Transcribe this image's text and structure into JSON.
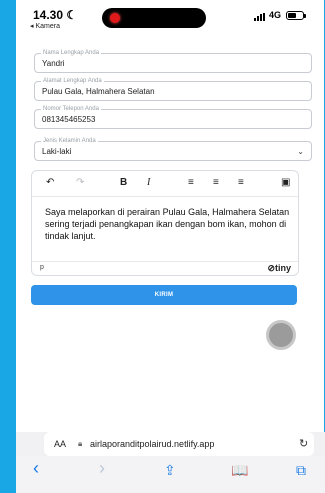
{
  "status": {
    "time": "14.30",
    "back_app": "◂ Kamera",
    "network": "4G"
  },
  "form": {
    "name": {
      "label": "Nama Lengkap Anda",
      "value": "Yandri"
    },
    "address": {
      "label": "Alamat Lengkap Anda",
      "value": "Pulau Gala, Halmahera Selatan"
    },
    "phone": {
      "label": "Nomor Telepon Anda",
      "value": "081345465253"
    },
    "gender": {
      "label": "Jenis Kelamin Anda",
      "value": "Laki-laki"
    }
  },
  "editor": {
    "text": "Saya melaporkan di perairan Pulau Gala, Halmahera Selatan sering terjadi penangkapan ikan dengan bom ikan, mohon di tindak lanjut.",
    "path": "p",
    "brand": "tiny",
    "toolbar": {
      "undo": "↶",
      "redo": "↷",
      "bold": "B",
      "italic": "I",
      "align_left": "≡",
      "align_center": "≡",
      "align_right": "≡",
      "image": "▣"
    }
  },
  "submit_label": "KIRIM",
  "browser": {
    "aa": "AA",
    "url": "airlaporanditpolairud.netlify.app",
    "reload": "↻",
    "nav": {
      "back": "‹",
      "forward": "›",
      "share": "⇪",
      "bookmarks": "📖",
      "tabs": "⧉"
    }
  },
  "icons": [
    "moon-icon",
    "camera-dot-icon",
    "signal-icon",
    "battery-icon",
    "chevron-down-icon",
    "undo-icon",
    "redo-icon",
    "bold-icon",
    "italic-icon",
    "align-left-icon",
    "align-center-icon",
    "align-right-icon",
    "image-icon",
    "lock-icon",
    "reload-icon",
    "back-icon",
    "forward-icon",
    "share-icon",
    "bookmarks-icon",
    "tabs-icon"
  ],
  "colors": {
    "background": "#19a7e6",
    "submit": "#2f94e9",
    "nav_accent": "#1a7be6"
  }
}
